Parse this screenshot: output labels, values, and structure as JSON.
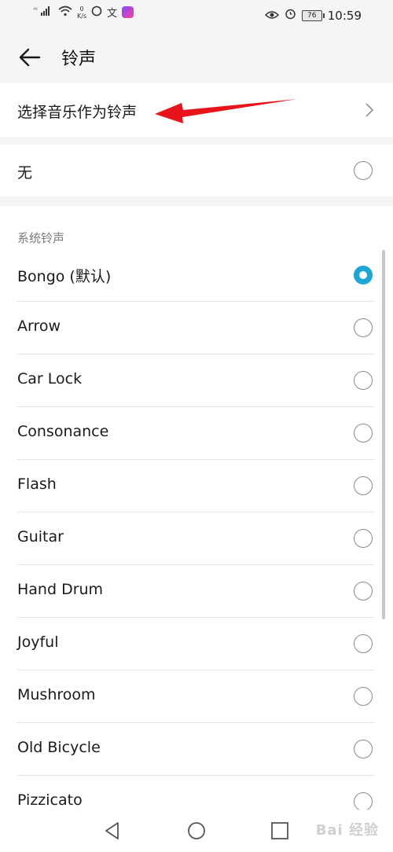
{
  "status_bar": {
    "signal_label": "⁴⁶",
    "speed_value": "0",
    "speed_unit": "K/s",
    "battery_level": "76",
    "time": "10:59"
  },
  "header": {
    "title": "铃声"
  },
  "select_music": {
    "label": "选择音乐作为铃声"
  },
  "none_option": {
    "label": "无",
    "selected": false
  },
  "system_ringtones": {
    "section_title": "系统铃声",
    "items": [
      {
        "label": "Bongo (默认)",
        "selected": true
      },
      {
        "label": "Arrow",
        "selected": false
      },
      {
        "label": "Car Lock",
        "selected": false
      },
      {
        "label": "Consonance",
        "selected": false
      },
      {
        "label": "Flash",
        "selected": false
      },
      {
        "label": "Guitar",
        "selected": false
      },
      {
        "label": "Hand Drum",
        "selected": false
      },
      {
        "label": "Joyful",
        "selected": false
      },
      {
        "label": "Mushroom",
        "selected": false
      },
      {
        "label": "Old Bicycle",
        "selected": false
      },
      {
        "label": "Pizzicato",
        "selected": false
      }
    ]
  },
  "colors": {
    "accent": "#1ba6d6",
    "annotation_arrow": "#e8141c"
  },
  "watermark": "Bai 经验"
}
